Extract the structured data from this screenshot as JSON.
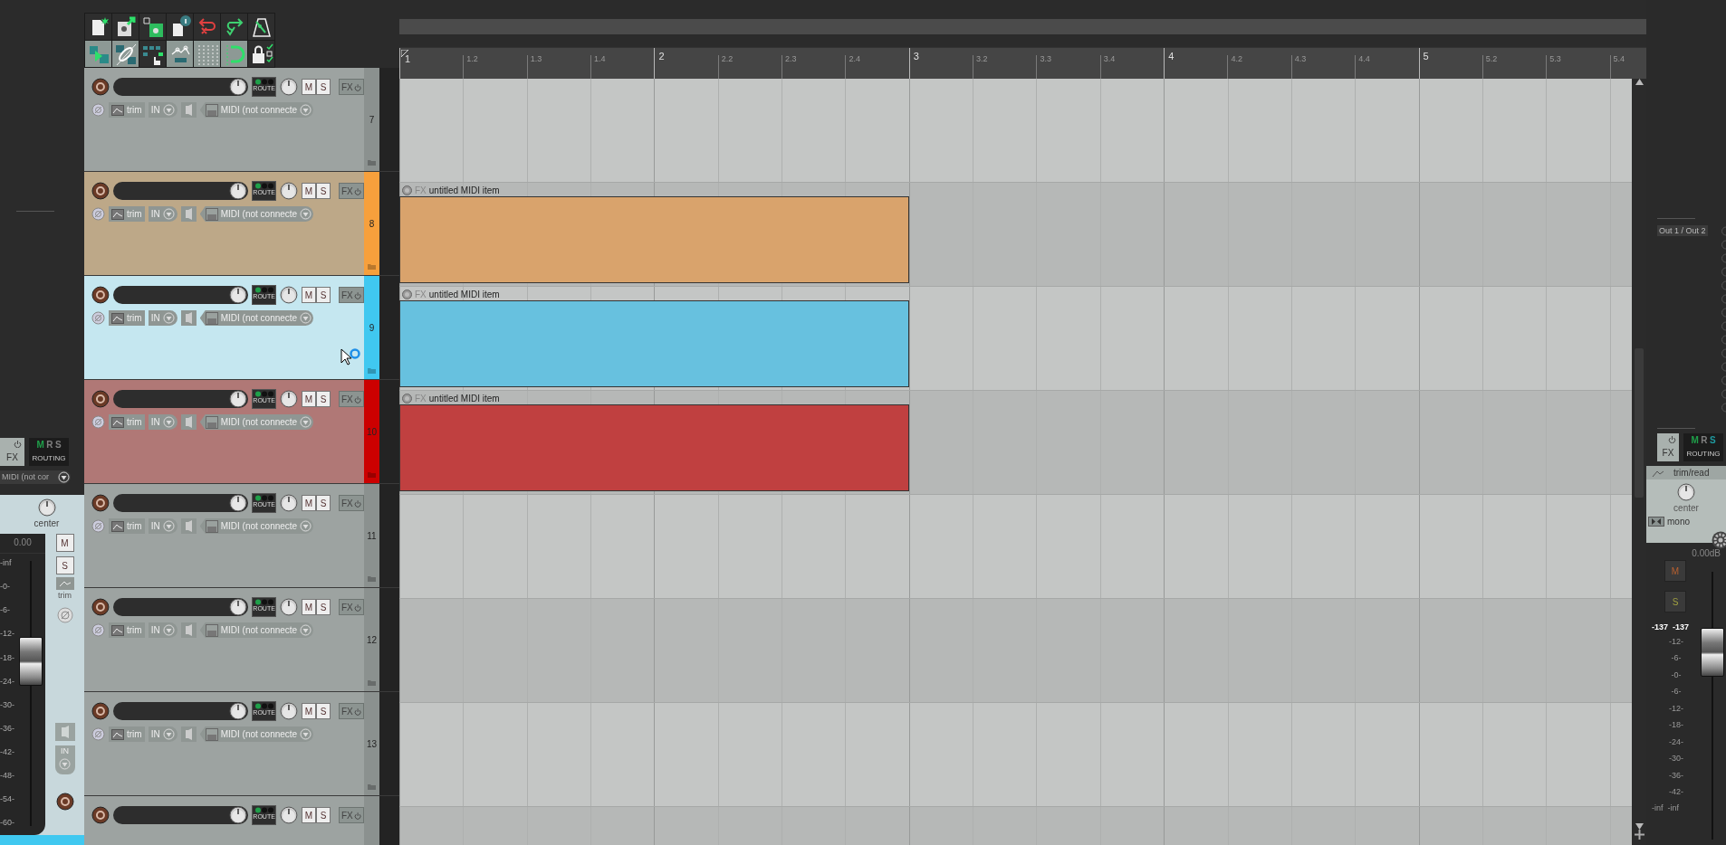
{
  "toolbar": {
    "buttons": [
      {
        "on": false
      },
      {
        "on": false
      },
      {
        "on": false
      },
      {
        "on": false
      },
      {
        "on": false
      },
      {
        "on": false
      },
      {
        "on": false
      },
      {
        "on": true
      },
      {
        "on": true
      },
      {
        "on": false
      },
      {
        "on": true
      },
      {
        "on": true
      },
      {
        "on": true
      },
      {
        "on": false
      }
    ]
  },
  "left_strip": {
    "fx": "FX",
    "routing": "ROUTING",
    "routing_flags": [
      {
        "label": "M",
        "color": "#1fa04a"
      },
      {
        "label": "R",
        "color": "#808080"
      },
      {
        "label": "S",
        "color": "#808080"
      }
    ],
    "input": "MIDI (not cor",
    "pan": "center",
    "volume": "0.00",
    "mute": "M",
    "solo": "S",
    "trim": "trim",
    "in": "IN",
    "scale": [
      "-inf",
      "-0-",
      "-6-",
      "-12-",
      "-18-",
      "-24-",
      "-30-",
      "-36-",
      "-42-",
      "-48-",
      "-54-",
      "-60-"
    ],
    "fader": {
      "level": 0.62
    },
    "color": "#40c8f0"
  },
  "ruler": {
    "marks": [
      {
        "label": "1",
        "kind": "bar"
      },
      {
        "label": "1.2",
        "kind": "beat"
      },
      {
        "label": "1.3",
        "kind": "beat"
      },
      {
        "label": "1.4",
        "kind": "beat"
      },
      {
        "label": "2",
        "kind": "bar"
      },
      {
        "label": "2.2",
        "kind": "beat"
      },
      {
        "label": "2.3",
        "kind": "beat"
      },
      {
        "label": "2.4",
        "kind": "beat"
      },
      {
        "label": "3",
        "kind": "bar"
      },
      {
        "label": "3.2",
        "kind": "beat"
      },
      {
        "label": "3.3",
        "kind": "beat"
      },
      {
        "label": "3.4",
        "kind": "beat"
      },
      {
        "label": "4",
        "kind": "bar"
      },
      {
        "label": "4.2",
        "kind": "beat"
      },
      {
        "label": "4.3",
        "kind": "beat"
      },
      {
        "label": "4.4",
        "kind": "beat"
      },
      {
        "label": "5",
        "kind": "bar"
      },
      {
        "label": "5.2",
        "kind": "beat"
      },
      {
        "label": "5.3",
        "kind": "beat"
      },
      {
        "label": "5.4",
        "kind": "beat"
      }
    ]
  },
  "tracks": [
    {
      "number": "7",
      "color": "#8b918f",
      "selected": false,
      "route": "ROUTE",
      "mute": "M",
      "solo": "S",
      "fx": "FX",
      "trim": "trim",
      "in": "IN",
      "input": "MIDI (not connecte"
    },
    {
      "number": "8",
      "color": "#f7a03c",
      "selected": false,
      "route": "ROUTE",
      "mute": "M",
      "solo": "S",
      "fx": "FX",
      "trim": "trim",
      "in": "IN",
      "input": "MIDI (not connecte",
      "item": {
        "fx": "FX",
        "name": "untitled MIDI item",
        "color": "#d9a36c"
      }
    },
    {
      "number": "9",
      "color": "#40c8f0",
      "selected": true,
      "route": "ROUTE",
      "mute": "M",
      "solo": "S",
      "fx": "FX",
      "trim": "trim",
      "in": "IN",
      "input": "MIDI (not connecte",
      "item": {
        "fx": "FX",
        "name": "untitled MIDI item",
        "color": "#67c1df"
      }
    },
    {
      "number": "10",
      "color": "#cc0000",
      "selected": false,
      "route": "ROUTE",
      "mute": "M",
      "solo": "S",
      "fx": "FX",
      "trim": "trim",
      "in": "IN",
      "input": "MIDI (not connecte",
      "item": {
        "fx": "FX",
        "name": "untitled MIDI item",
        "color": "#c04040"
      }
    },
    {
      "number": "11",
      "color": "#8b918f",
      "selected": false,
      "route": "ROUTE",
      "mute": "M",
      "solo": "S",
      "fx": "FX",
      "trim": "trim",
      "in": "IN",
      "input": "MIDI (not connecte"
    },
    {
      "number": "12",
      "color": "#8b918f",
      "selected": false,
      "route": "ROUTE",
      "mute": "M",
      "solo": "S",
      "fx": "FX",
      "trim": "trim",
      "in": "IN",
      "input": "MIDI (not connecte"
    },
    {
      "number": "13",
      "color": "#8b918f",
      "selected": false,
      "route": "ROUTE",
      "mute": "M",
      "solo": "S",
      "fx": "FX",
      "trim": "trim",
      "in": "IN",
      "input": "MIDI (not connecte"
    },
    {
      "color": "#8b918f",
      "selected": false,
      "route": "ROUTE",
      "mute": "M",
      "solo": "S",
      "fx": "FX"
    }
  ],
  "master": {
    "output": "Out 1 / Out 2",
    "fx": "FX",
    "routing": "ROUTING",
    "routing_flags": [
      {
        "label": "M",
        "color": "#1fa04a"
      },
      {
        "label": "R",
        "color": "#808080"
      },
      {
        "label": "S",
        "color": "#1f9aa0"
      }
    ],
    "automation": "trim/read",
    "pan": "center",
    "mono": "mono",
    "volume": "0.00dB",
    "mute": "M",
    "solo": "S",
    "peaks": [
      "-137",
      "-137"
    ],
    "scale": [
      "-12-",
      "-6-",
      "-0-",
      "-6-",
      "-12-",
      "-18-",
      "-24-",
      "-30-",
      "-36-",
      "-42-"
    ],
    "floor": [
      "-inf",
      "-inf"
    ],
    "fader": {
      "level": 0.7
    }
  }
}
